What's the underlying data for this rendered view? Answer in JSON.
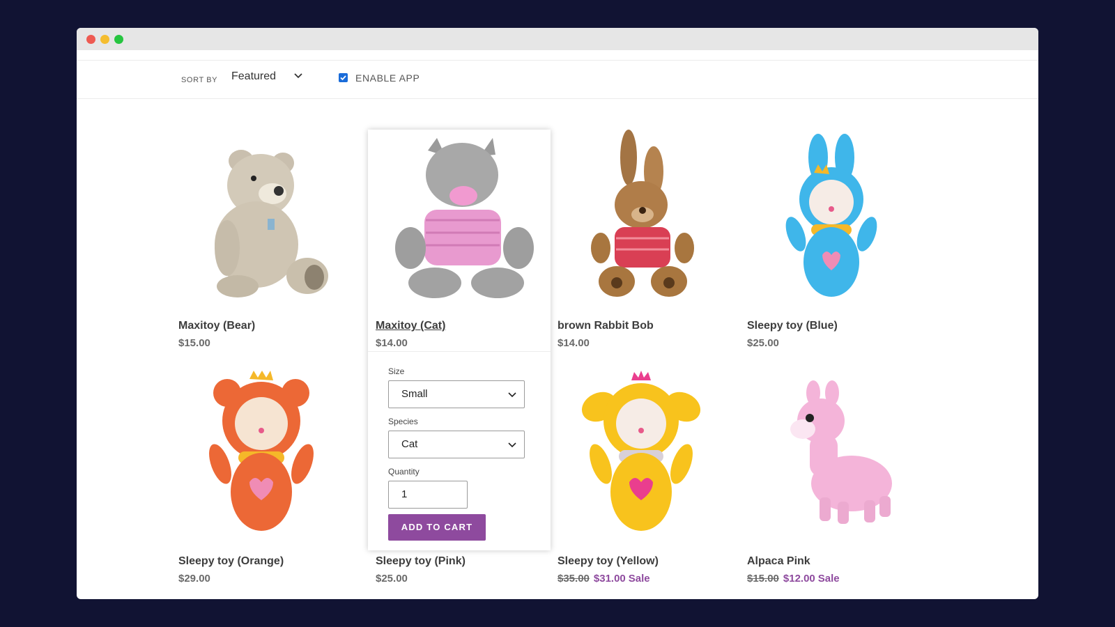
{
  "toolbar": {
    "sort_label": "SORT BY",
    "sort_value": "Featured",
    "enable_label": "ENABLE APP",
    "enable_checked": true
  },
  "products": [
    {
      "name": "Maxitoy (Bear)",
      "price": "$15.00"
    },
    {
      "name": "Maxitoy (Cat)",
      "price": "$14.00"
    },
    {
      "name": "brown Rabbit Bob",
      "price": "$14.00"
    },
    {
      "name": "Sleepy toy (Blue)",
      "price": "$25.00"
    },
    {
      "name": "Sleepy toy (Orange)",
      "price": "$29.00"
    },
    {
      "name": "Sleepy toy (Pink)",
      "price": "$25.00"
    },
    {
      "name": "Sleepy toy (Yellow)",
      "old_price": "$35.00",
      "sale_price": "$31.00",
      "sale_label": "Sale"
    },
    {
      "name": "Alpaca Pink",
      "old_price": "$15.00",
      "sale_price": "$12.00",
      "sale_label": "Sale"
    }
  ],
  "quick_view": {
    "size_label": "Size",
    "size_value": "Small",
    "species_label": "Species",
    "species_value": "Cat",
    "quantity_label": "Quantity",
    "quantity_value": "1",
    "add_to_cart": "ADD TO CART"
  },
  "colors": {
    "accent": "#8e4a9e",
    "background": "#111333",
    "checkbox": "#1a6cd9"
  }
}
